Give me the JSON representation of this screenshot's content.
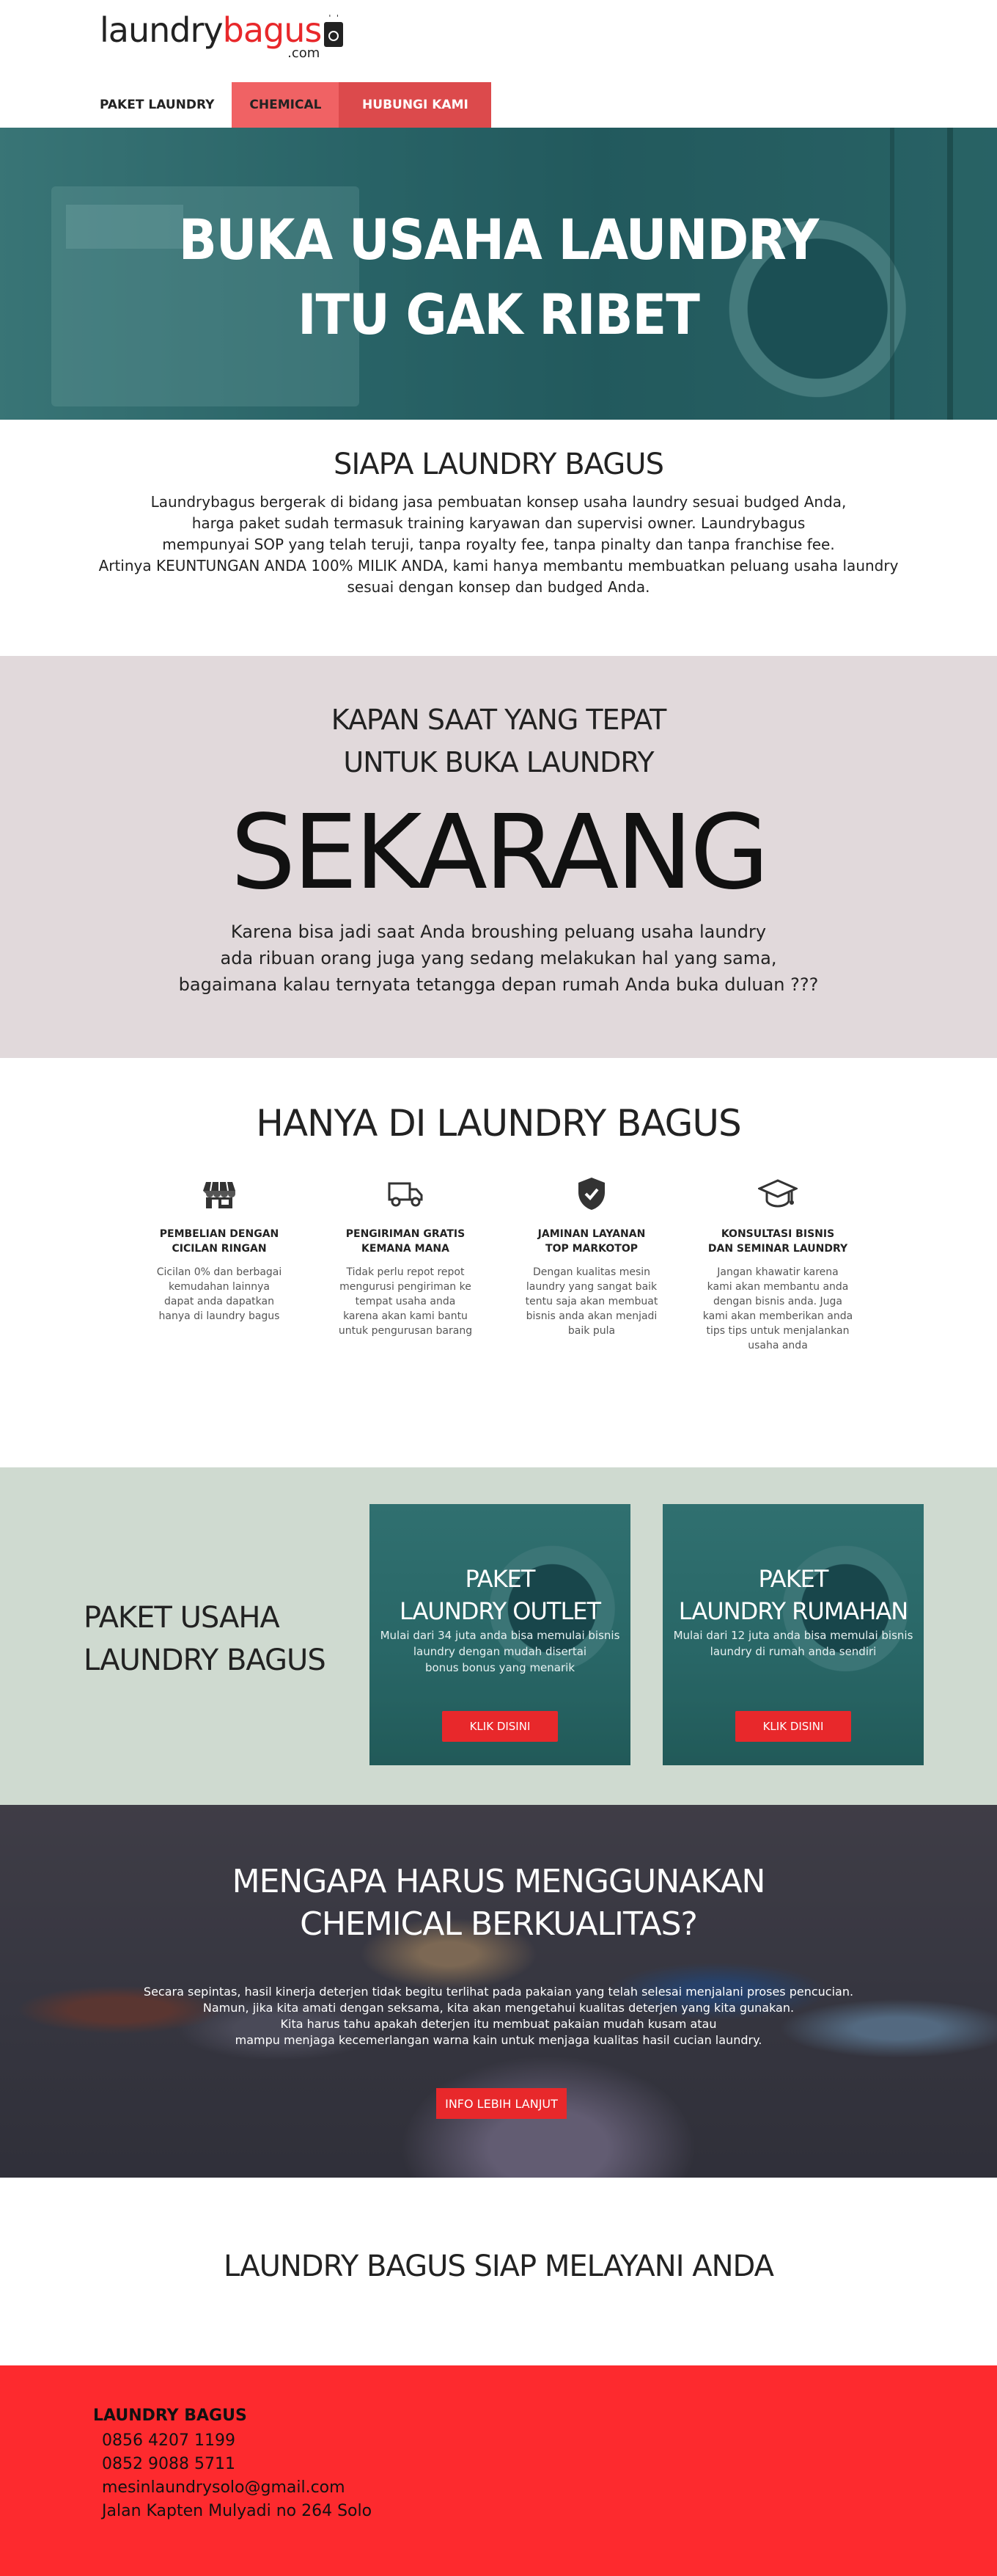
{
  "brand": {
    "logo_part1": "laundry",
    "logo_part2": "bagus",
    "logo_suffix": ".com",
    "accent_color": "#e8282b"
  },
  "nav": {
    "items": [
      {
        "label": "PAKET LAUNDRY"
      },
      {
        "label": "CHEMICAL"
      },
      {
        "label": "HUBUNGI KAMI"
      }
    ]
  },
  "hero": {
    "line1": "BUKA USAHA LAUNDRY",
    "line2": "ITU GAK RIBET"
  },
  "about": {
    "title": "SIAPA LAUNDRY BAGUS",
    "lines": [
      "Laundrybagus bergerak di bidang jasa pembuatan konsep usaha laundry sesuai budged Anda,",
      "harga paket sudah termasuk training karyawan dan supervisi owner. Laundrybagus",
      "mempunyai SOP yang telah teruji, tanpa royalty fee, tanpa pinalty dan tanpa franchise fee.",
      "Artinya KEUNTUNGAN ANDA 100% MILIK ANDA, kami hanya membantu membuatkan peluang usaha laundry",
      "sesuai dengan konsep dan budged Anda."
    ]
  },
  "kapan": {
    "line1": "KAPAN SAAT YANG TEPAT",
    "line2": "UNTUK BUKA LAUNDRY",
    "big": "SEKARANG",
    "lines": [
      "Karena bisa jadi saat Anda broushing peluang usaha laundry",
      "ada ribuan orang juga yang sedang melakukan hal yang sama,",
      "bagaimana kalau ternyata tetangga depan rumah Anda buka duluan ???"
    ]
  },
  "hanya": {
    "title": "HANYA DI LAUNDRY BAGUS",
    "features": [
      {
        "icon": "store-icon",
        "title1": "PEMBELIAN DENGAN",
        "title2": "CICILAN RINGAN",
        "desc": [
          "Cicilan 0% dan berbagai",
          "kemudahan lainnya",
          "dapat anda dapatkan",
          "hanya di  laundry bagus"
        ]
      },
      {
        "icon": "truck-icon",
        "title1": "PENGIRIMAN GRATIS",
        "title2": "KEMANA MANA",
        "desc": [
          "Tidak perlu repot repot",
          "mengurusi pengiriman ke",
          "tempat usaha anda",
          "karena akan kami bantu",
          "untuk pengurusan barang"
        ]
      },
      {
        "icon": "shield-check-icon",
        "title1": "JAMINAN LAYANAN",
        "title2": "TOP MARKOTOP",
        "desc": [
          "Dengan kualitas mesin",
          "laundry yang sangat baik",
          "tentu saja akan membuat",
          "bisnis anda akan menjadi",
          "baik pula"
        ]
      },
      {
        "icon": "graduation-cap-icon",
        "title1": "KONSULTASI BISNIS",
        "title2": "DAN SEMINAR LAUNDRY",
        "desc": [
          "Jangan khawatir karena",
          "kami akan membantu anda",
          "dengan bisnis anda. Juga",
          "kami akan memberikan anda",
          "tips tips untuk menjalankan",
          "usaha anda"
        ]
      }
    ]
  },
  "paket": {
    "title1": "PAKET USAHA",
    "title2": "LAUNDRY BAGUS",
    "cards": [
      {
        "t1": "PAKET",
        "t2": "LAUNDRY OUTLET",
        "desc": [
          "Mulai dari 34 juta anda bisa memulai bisnis",
          "laundry dengan mudah disertai",
          "bonus bonus yang menarik"
        ],
        "button": "KLIK DISINI"
      },
      {
        "t1": "PAKET",
        "t2": "LAUNDRY RUMAHAN",
        "desc": [
          "Mulai dari 12 juta anda bisa memulai bisnis",
          "laundry di rumah anda sendiri"
        ],
        "button": "KLIK DISINI"
      }
    ]
  },
  "chemical": {
    "line1": "MENGAPA HARUS MENGGUNAKAN",
    "line2": "CHEMICAL BERKUALITAS?",
    "lines": [
      "Secara sepintas, hasil kinerja deterjen tidak begitu terlihat pada pakaian yang telah selesai menjalani proses pencucian.",
      "Namun, jika kita amati dengan seksama, kita akan mengetahui kualitas deterjen yang kita gunakan.",
      "Kita harus tahu apakah deterjen itu membuat pakaian mudah kusam atau",
      "mampu menjaga kecemerlangan warna kain untuk menjaga kualitas hasil cucian laundry."
    ],
    "button": "INFO LEBIH LANJUT"
  },
  "siap": {
    "title": "LAUNDRY BAGUS SIAP MELAYANI ANDA"
  },
  "footer": {
    "name": "LAUNDRY BAGUS",
    "phone1": "0856 4207 1199",
    "phone2": "0852 9088 5711",
    "email": "mesinlaundrysolo@gmail.com",
    "address": "Jalan Kapten Mulyadi no 264 Solo",
    "bg_color": "#fd2a2e"
  }
}
